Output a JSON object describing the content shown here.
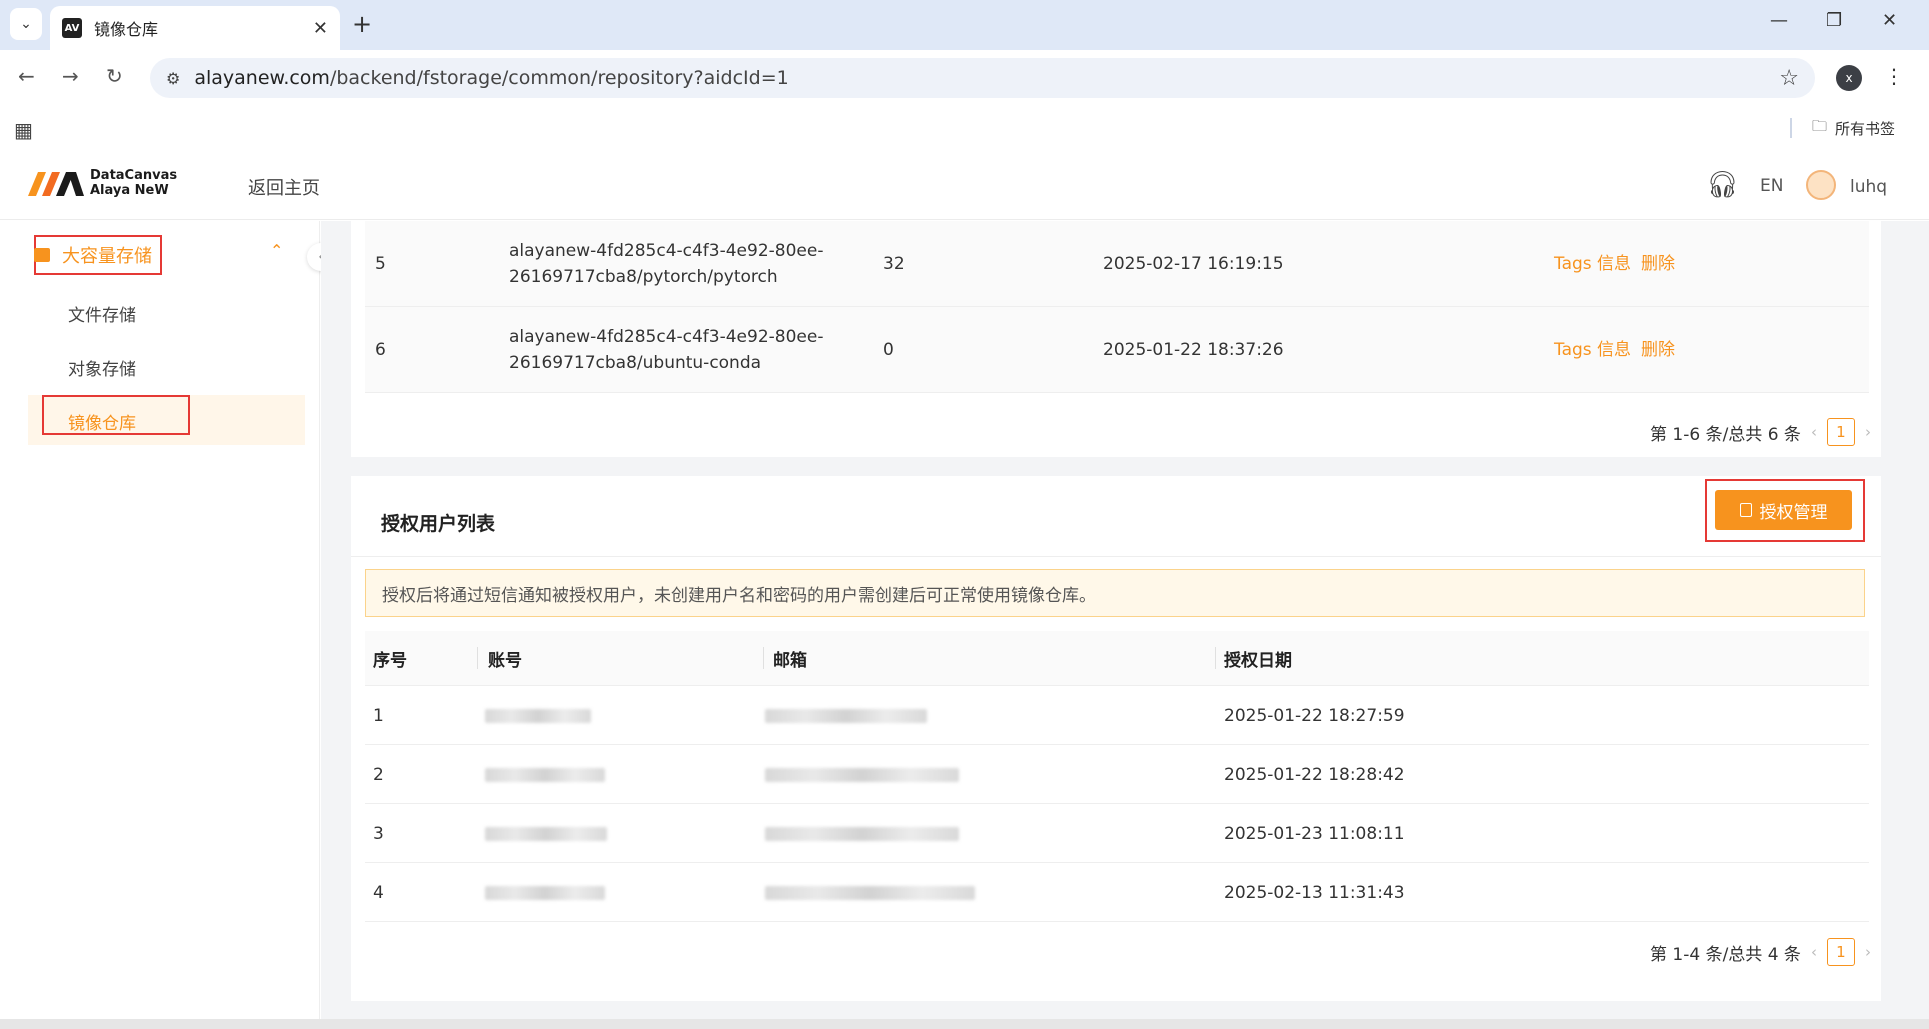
{
  "browser": {
    "tab_title": "镜像仓库",
    "url_host": "alayanew.com",
    "url_path": "/backend/fstorage/common/repository?aidcId=1",
    "profile_initial": "x",
    "bookmark_folder": "所有书签"
  },
  "header": {
    "logo_line1": "DataCanvas",
    "logo_line2": "Alaya NeW",
    "back_home": "返回主页",
    "lang": "EN",
    "user": "luhq"
  },
  "sidebar": {
    "group_label": "大容量存储",
    "items": [
      {
        "label": "文件存储"
      },
      {
        "label": "对象存储"
      },
      {
        "label": "镜像仓库"
      }
    ]
  },
  "repo_table": {
    "rows": [
      {
        "idx": "5",
        "name_line1": "alayanew-4fd285c4-c4f3-4e92-80ee-",
        "name_line2": "26169717cba8/pytorch/pytorch",
        "count": "32",
        "date": "2025-02-17 16:19:15",
        "act_tags": "Tags 信息",
        "act_delete": "删除"
      },
      {
        "idx": "6",
        "name_line1": "alayanew-4fd285c4-c4f3-4e92-80ee-",
        "name_line2": "26169717cba8/ubuntu-conda",
        "count": "0",
        "date": "2025-01-22 18:37:26",
        "act_tags": "Tags 信息",
        "act_delete": "删除"
      }
    ],
    "pager_summary": "第 1-6 条/总共 6 条",
    "pager_page": "1"
  },
  "auth_section": {
    "title": "授权用户列表",
    "button_label": "授权管理",
    "notice": "授权后将通过短信通知被授权用户，未创建用户名和密码的用户需创建后可正常使用镜像仓库。",
    "columns": [
      "序号",
      "账号",
      "邮箱",
      "授权日期"
    ],
    "rows": [
      {
        "idx": "1",
        "date": "2025-01-22 18:27:59"
      },
      {
        "idx": "2",
        "date": "2025-01-22 18:28:42"
      },
      {
        "idx": "3",
        "date": "2025-01-23 11:08:11"
      },
      {
        "idx": "4",
        "date": "2025-02-13 11:31:43"
      }
    ],
    "pager_summary": "第 1-4 条/总共 4 条",
    "pager_page": "1"
  },
  "icons": {
    "tab_dropdown": "chevron-down-icon",
    "close": "close-icon",
    "new_tab": "plus-icon",
    "back": "arrow-left-icon",
    "forward": "arrow-right-icon",
    "reload": "reload-icon",
    "site_info": "tune-icon",
    "bookmark": "star-icon",
    "menu": "kebab-menu-icon",
    "apps": "apps-grid-icon",
    "folder": "folder-icon",
    "headset": "headset-icon",
    "chevron_up": "chevron-up-icon",
    "collapse": "chevron-left-icon",
    "doc": "document-icon"
  },
  "colors": {
    "accent": "#f7931e",
    "highlight_box": "#e53935",
    "notice_bg": "#fff8e9"
  }
}
